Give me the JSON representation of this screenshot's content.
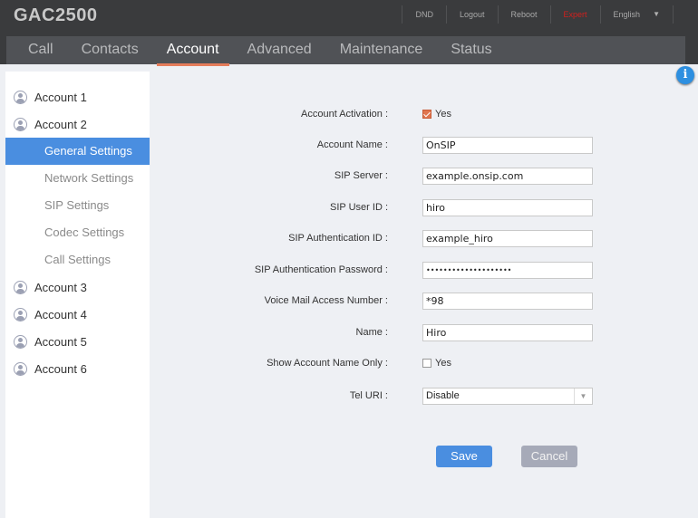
{
  "app": {
    "title": "GAC2500"
  },
  "toplinks": {
    "dnd": "DND",
    "logout": "Logout",
    "reboot": "Reboot",
    "expert": "Expert",
    "language": "English",
    "expert_color": "#d0201e"
  },
  "tabs": [
    {
      "label": "Call"
    },
    {
      "label": "Contacts"
    },
    {
      "label": "Account",
      "active": true
    },
    {
      "label": "Advanced"
    },
    {
      "label": "Maintenance"
    },
    {
      "label": "Status"
    }
  ],
  "sidebar": {
    "accounts": [
      "Account 1",
      "Account 2",
      "Account 3",
      "Account 4",
      "Account 5",
      "Account 6"
    ],
    "subitems": [
      "General Settings",
      "Network Settings",
      "SIP Settings",
      "Codec Settings",
      "Call Settings"
    ],
    "active_sub": "General Settings"
  },
  "form": {
    "account_activation": {
      "label": "Account Activation :",
      "option": "Yes",
      "checked": true
    },
    "account_name": {
      "label": "Account Name :",
      "value": "OnSIP"
    },
    "sip_server": {
      "label": "SIP Server :",
      "value": "example.onsip.com"
    },
    "sip_user_id": {
      "label": "SIP User ID :",
      "value": "hiro"
    },
    "sip_auth_id": {
      "label": "SIP Authentication ID :",
      "value": "example_hiro"
    },
    "sip_auth_password": {
      "label": "SIP Authentication Password :",
      "value": "••••••••••••••••••••"
    },
    "voicemail": {
      "label": "Voice Mail Access Number :",
      "value": "*98"
    },
    "name": {
      "label": "Name :",
      "value": "Hiro"
    },
    "show_account_name_only": {
      "label": "Show Account Name Only :",
      "option": "Yes",
      "checked": false
    },
    "tel_uri": {
      "label": "Tel URI :",
      "value": "Disable"
    }
  },
  "buttons": {
    "save": "Save",
    "cancel": "Cancel"
  },
  "colors": {
    "accent": "#4a8ee0",
    "tab_underline": "#e57c5a",
    "checkbox": "#e0764f"
  }
}
